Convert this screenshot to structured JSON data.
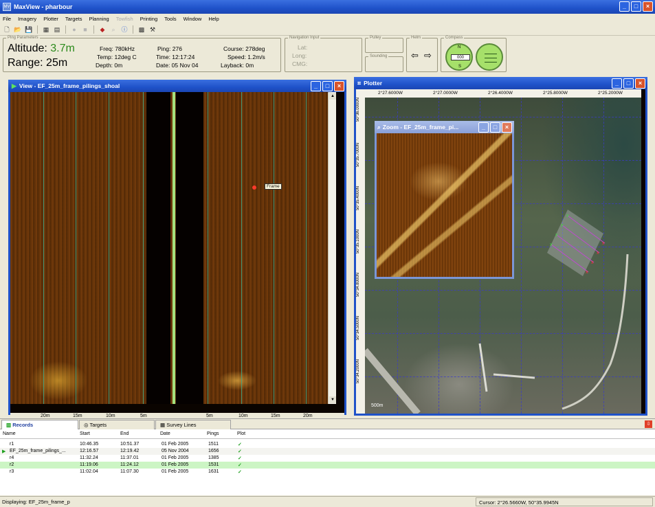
{
  "app": {
    "title": "MaxView - pharbour",
    "icon_label": "MV"
  },
  "menu": [
    "File",
    "Imagery",
    "Plotter",
    "Targets",
    "Planning",
    "Towfish",
    "Printing",
    "Tools",
    "Window",
    "Help"
  ],
  "menu_disabled": [
    "Towfish"
  ],
  "ribbon": {
    "ping_params": {
      "group_label": "Ping Parameters",
      "altitude_label": "Altitude:",
      "altitude_value": "3.7m",
      "range_label": "Range:",
      "range_value": "25m",
      "freq": "Freq: 780kHz",
      "temp": "Temp: 12deg C",
      "depth": "Depth: 0m",
      "ping": "Ping: 276",
      "time": "Time: 12:17:24",
      "date": "Date: 05 Nov 04",
      "course": "Course: 278deg",
      "speed": "Speed: 1.2m/s",
      "layback": "Layback: 0m"
    },
    "nav_input": {
      "group_label": "Navigation Input",
      "lat": "Lat:",
      "long": "Long:",
      "cmg": "CMG:"
    },
    "pulley": {
      "group_label": "Pulley"
    },
    "sounding": {
      "group_label": "Sounding"
    },
    "helm": {
      "group_label": "Helm",
      "left": "⇦",
      "right": "⇨"
    },
    "compass": {
      "group_label": "Compass",
      "n": "N",
      "s": "S",
      "readout": "000"
    }
  },
  "view_window": {
    "title": "View - EF_25m_frame_pilings_shoal",
    "target_label": "Frame",
    "ruler": [
      "20m",
      "15m",
      "10m",
      "5m",
      "5m",
      "10m",
      "15m",
      "20m"
    ]
  },
  "plotter_window": {
    "title": "Plotter",
    "x_ticks": [
      "2°27.6000W",
      "2°27.0000W",
      "2°26.4000W",
      "2°25.8000W",
      "2°25.2000W"
    ],
    "y_ticks": [
      "50°36.0000N",
      "50°35.7000N",
      "50°35.4000N",
      "50°35.1000N",
      "50°34.8000N",
      "50°34.5000N",
      "50°34.2000N"
    ],
    "scale_label": "500m"
  },
  "zoom_window": {
    "title": "Zoom - EF_25m_frame_pi..."
  },
  "records": {
    "tabs": [
      "Records",
      "Targets",
      "Survey Lines"
    ],
    "columns": [
      "Name",
      "Start",
      "End",
      "Date",
      "Pings",
      "Plot"
    ],
    "rows": [
      {
        "name": "r1",
        "start": "10:46.35",
        "end": "10:51.37",
        "date": "01 Feb 2005",
        "pings": "1511",
        "plot": "✓"
      },
      {
        "name": "EF_25m_frame_pilings_...",
        "start": "12:16.57",
        "end": "12:19.42",
        "date": "05 Nov 2004",
        "pings": "1656",
        "plot": "✓"
      },
      {
        "name": "r4",
        "start": "11:32.24",
        "end": "11:37.01",
        "date": "01 Feb 2005",
        "pings": "1385",
        "plot": "✓"
      },
      {
        "name": "r2",
        "start": "11:19.06",
        "end": "11:24.12",
        "date": "01 Feb 2005",
        "pings": "1531",
        "plot": "✓"
      },
      {
        "name": "r3",
        "start": "11:02.04",
        "end": "11:07.30",
        "date": "01 Feb 2005",
        "pings": "1631",
        "plot": "✓"
      }
    ]
  },
  "status": {
    "left": "Displaying: EF_25m_frame_p",
    "right": "Cursor: 2°26.5660W, 50°35.9945N"
  },
  "colors": {
    "accent": "#1f52c9",
    "altitude_green": "#2b8a1c",
    "selected_row": "#ccf5c4"
  }
}
